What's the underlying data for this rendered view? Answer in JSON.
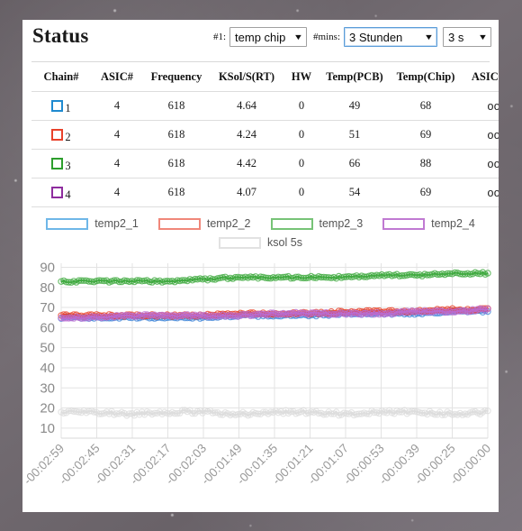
{
  "window": {
    "background_color": "#6a6368",
    "card_background": "#ffffff"
  },
  "header": {
    "title": "Status",
    "source_label": "#1:",
    "source_value": "temp chip",
    "range_label": "#mins:",
    "range_value": "3 Stunden",
    "rate_value": "3 s",
    "caret_glyph": "▼"
  },
  "table": {
    "columns": [
      "Chain#",
      "ASIC#",
      "Frequency",
      "KSol/S(RT)",
      "HW",
      "Temp(PCB)",
      "Temp(Chip)",
      "ASIC status"
    ],
    "rows": [
      {
        "chain": "1",
        "color": "#1f8ad0",
        "asic": "4",
        "frequency": "618",
        "ksol": "4.64",
        "hw": "0",
        "temp_pcb": "49",
        "temp_chip": "68",
        "asic_status": "oooo"
      },
      {
        "chain": "2",
        "color": "#e8412a",
        "asic": "4",
        "frequency": "618",
        "ksol": "4.24",
        "hw": "0",
        "temp_pcb": "51",
        "temp_chip": "69",
        "asic_status": "oooo"
      },
      {
        "chain": "3",
        "color": "#2d9e2d",
        "asic": "4",
        "frequency": "618",
        "ksol": "4.42",
        "hw": "0",
        "temp_pcb": "66",
        "temp_chip": "88",
        "asic_status": "oooo"
      },
      {
        "chain": "4",
        "color": "#8e2d9e",
        "asic": "4",
        "frequency": "618",
        "ksol": "4.07",
        "hw": "0",
        "temp_pcb": "54",
        "temp_chip": "69",
        "asic_status": "oooo"
      }
    ]
  },
  "legend": {
    "items": [
      {
        "label": "temp2_1",
        "color": "#6fb7e8"
      },
      {
        "label": "temp2_2",
        "color": "#f0877a"
      },
      {
        "label": "temp2_3",
        "color": "#77c377"
      },
      {
        "label": "temp2_4",
        "color": "#c07ad2"
      },
      {
        "label": "ksol 5s",
        "color": "#e2e2e2"
      }
    ]
  },
  "chart_data": {
    "type": "line",
    "title": "",
    "xlabel": "",
    "ylabel": "",
    "grid": true,
    "legend_position": "top",
    "ylim": [
      5,
      92
    ],
    "yticks": [
      10,
      20,
      30,
      40,
      50,
      60,
      70,
      80,
      90
    ],
    "x": [
      "-00:02:59",
      "-00:02:45",
      "-00:02:31",
      "-00:02:17",
      "-00:02:03",
      "-00:01:49",
      "-00:01:35",
      "-00:01:21",
      "-00:01:07",
      "-00:00:53",
      "-00:00:39",
      "-00:00:25",
      "-00:00:00"
    ],
    "series": [
      {
        "name": "temp2_1",
        "color": "#3f86d8",
        "values": [
          65,
          65,
          65,
          65,
          65,
          66,
          66,
          66,
          67,
          67,
          67,
          68,
          68
        ]
      },
      {
        "name": "temp2_2",
        "color": "#e8412a",
        "values": [
          66,
          66,
          66,
          66,
          66,
          67,
          67,
          67,
          68,
          68,
          68,
          69,
          69
        ]
      },
      {
        "name": "temp2_3",
        "color": "#3fa93f",
        "values": [
          83,
          83,
          83,
          83,
          84,
          85,
          85,
          85,
          85,
          86,
          86,
          87,
          87
        ]
      },
      {
        "name": "temp2_4",
        "color": "#b96bd0",
        "values": [
          65,
          65,
          66,
          66,
          66,
          66,
          67,
          67,
          67,
          67,
          68,
          68,
          69
        ]
      },
      {
        "name": "ksol 5s",
        "color": "#dcdcdc",
        "values": [
          18,
          18,
          17,
          18,
          18,
          17,
          18,
          18,
          17,
          18,
          18,
          17,
          18
        ]
      }
    ]
  }
}
